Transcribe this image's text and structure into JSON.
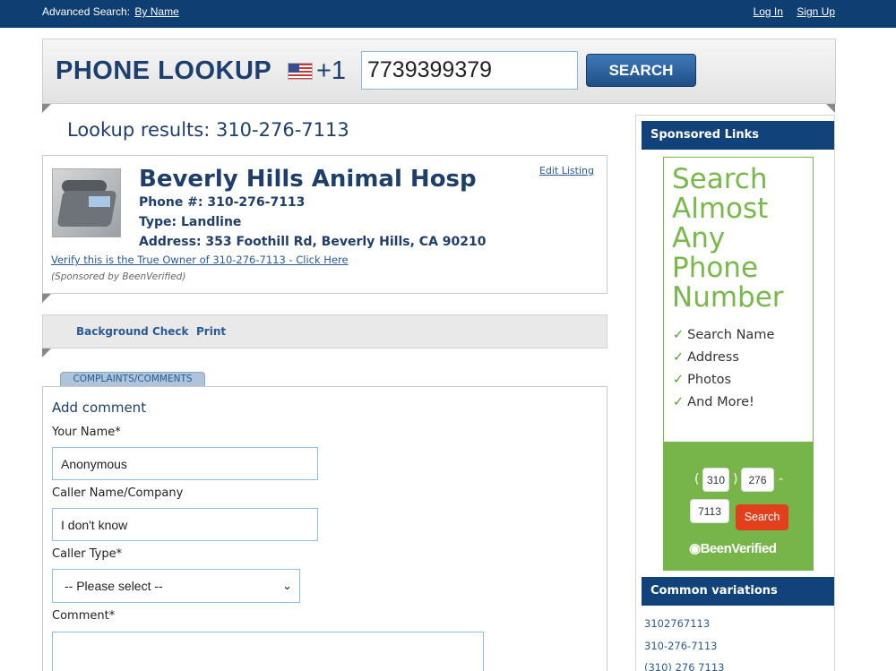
{
  "topbar": {
    "advanced_label": "Advanced Search:",
    "by_name": "By Name",
    "login": "Log In",
    "signup": "Sign Up"
  },
  "lookup": {
    "title": "PHONE LOOKUP",
    "country_code": "+1",
    "phone_value": "7739399379",
    "search_label": "SEARCH"
  },
  "results": {
    "title": "Lookup results: 310-276-7113"
  },
  "listing": {
    "business_name": "Beverly Hills Animal Hosp",
    "phone": "Phone #: 310-276-7113",
    "type": "Type: Landline",
    "address": "Address: 353 Foothill Rd, Beverly Hills, CA 90210",
    "edit_link": "Edit Listing",
    "verify_link": "Verify this is the True Owner of 310-276-7113 - Click Here",
    "sponsored": "(Sponsored by BeenVerified)"
  },
  "actions": {
    "background_check": "Background Check",
    "print": "Print"
  },
  "comments": {
    "tab_label": "COMPLAINTS/COMMENTS",
    "heading": "Add comment",
    "name_label": "Your Name*",
    "name_value": "Anonymous",
    "caller_label": "Caller Name/Company",
    "caller_value": "I don't know",
    "type_label": "Caller Type*",
    "type_selected": "-- Please select --",
    "comment_label": "Comment*"
  },
  "sidebar": {
    "sponsored_heading": "Sponsored Links",
    "ad_headline": [
      "Search",
      "Almost",
      "Any",
      "Phone",
      "Number"
    ],
    "ad_features": [
      "Search Name",
      "Address",
      "Photos",
      "And More!"
    ],
    "ad_area": "310",
    "ad_prefix": "276",
    "ad_line": "7113",
    "ad_search": "Search",
    "ad_brand": "BeenVerified",
    "variations_heading": "Common variations",
    "variations": [
      "3102767113",
      "310-276-7113",
      "(310) 276 7113"
    ]
  },
  "colors": {
    "brand_navy": "#0f3e73",
    "ad_green": "#77b54a",
    "ad_button": "#e2401c"
  }
}
